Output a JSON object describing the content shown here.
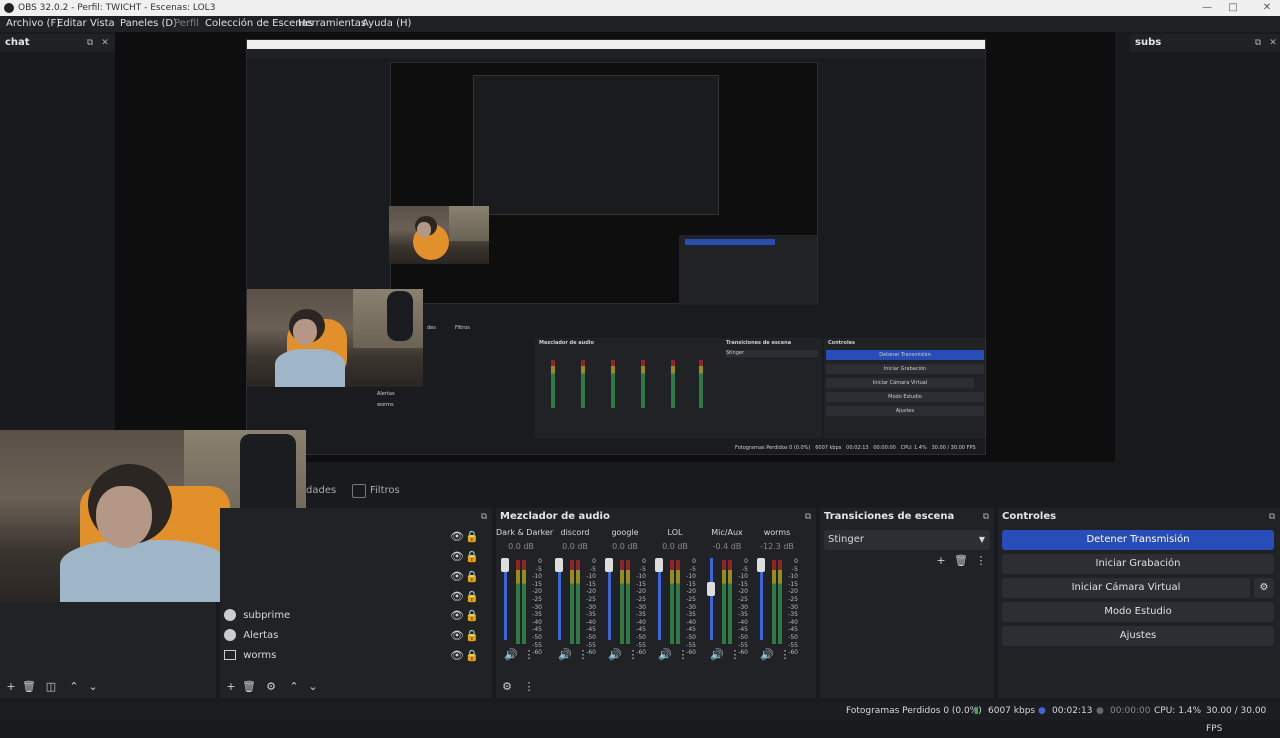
{
  "window": {
    "title": "OBS 32.0.2 - Perfil: TWICHT - Escenas: LOL3"
  },
  "menu": [
    {
      "label": "Archivo (F)",
      "dim": false
    },
    {
      "label": "Editar",
      "dim": false
    },
    {
      "label": "Vista",
      "dim": false
    },
    {
      "label": "Paneles (D)",
      "dim": false
    },
    {
      "label": "Perfil",
      "dim": true
    },
    {
      "label": "Colección de Escenas",
      "dim": false
    },
    {
      "label": "Herramientas",
      "dim": false
    },
    {
      "label": "Ayuda (H)",
      "dim": false
    }
  ],
  "docks": {
    "left": "chat",
    "right": "subs"
  },
  "tabs": {
    "properties": "dades",
    "filters": "Filtros"
  },
  "sources": [
    {
      "label": "subprime",
      "icon": "globe-icon"
    },
    {
      "label": "Alertas",
      "icon": "globe-icon"
    },
    {
      "label": "worms",
      "icon": "window-capture-icon"
    }
  ],
  "mixer": {
    "title": "Mezclador de audio",
    "channels": [
      {
        "name": "Dark & Darker",
        "db": "0.0 dB",
        "level": 0.0
      },
      {
        "name": "discord",
        "db": "0.0 dB",
        "level": 0.0
      },
      {
        "name": "google",
        "db": "0.0 dB",
        "level": 0.0
      },
      {
        "name": "LOL",
        "db": "0.0 dB",
        "level": 0.0
      },
      {
        "name": "Mic/Aux",
        "db": "-0.4 dB",
        "level": 0.35
      },
      {
        "name": "worms",
        "db": "-12.3 dB",
        "level": 0.0
      }
    ],
    "ticks": [
      "0",
      "-5",
      "-10",
      "-15",
      "-20",
      "-25",
      "-30",
      "-35",
      "-40",
      "-45",
      "-50",
      "-55",
      "-60"
    ]
  },
  "transitions": {
    "title": "Transiciones de escena",
    "selected": "Stinger"
  },
  "controls": {
    "title": "Controles",
    "stop_stream": "Detener Transmisión",
    "start_recording": "Iniciar Grabación",
    "virtual_cam": "Iniciar Cámara Virtual",
    "studio_mode": "Modo Estudio",
    "settings": "Ajustes"
  },
  "status": {
    "dropped": "Fotogramas Perdidos 0 (0.0%)",
    "bitrate": "6007 kbps",
    "stream_time": "00:02:13",
    "rec_time": "00:00:00",
    "cpu": "CPU: 1.4%",
    "fps": "30.00 / 30.00 FPS"
  },
  "nested": {
    "mixer": "Mezclador de audio",
    "transitions": "Transiciones de escena",
    "controls": "Controles",
    "stinger": "Stinger",
    "stop": "Detener Transmisión",
    "rec": "Iniciar Grabación",
    "vcam": "Iniciar Cámara Virtual",
    "studio": "Modo Estudio",
    "settings": "Ajustes",
    "status": "Fotogramas Perdidos 0 (0.0%)   6007 kbps   00:02:13   00:00:00   CPU: 1.4%   30.00 / 30.00 FPS",
    "sources": [
      "subprime",
      "Alertas",
      "worms"
    ],
    "filters": "Filtros",
    "props": "des"
  },
  "colors": {
    "accent": "#284cb8",
    "panel": "#202226",
    "bg": "#181a1d"
  }
}
